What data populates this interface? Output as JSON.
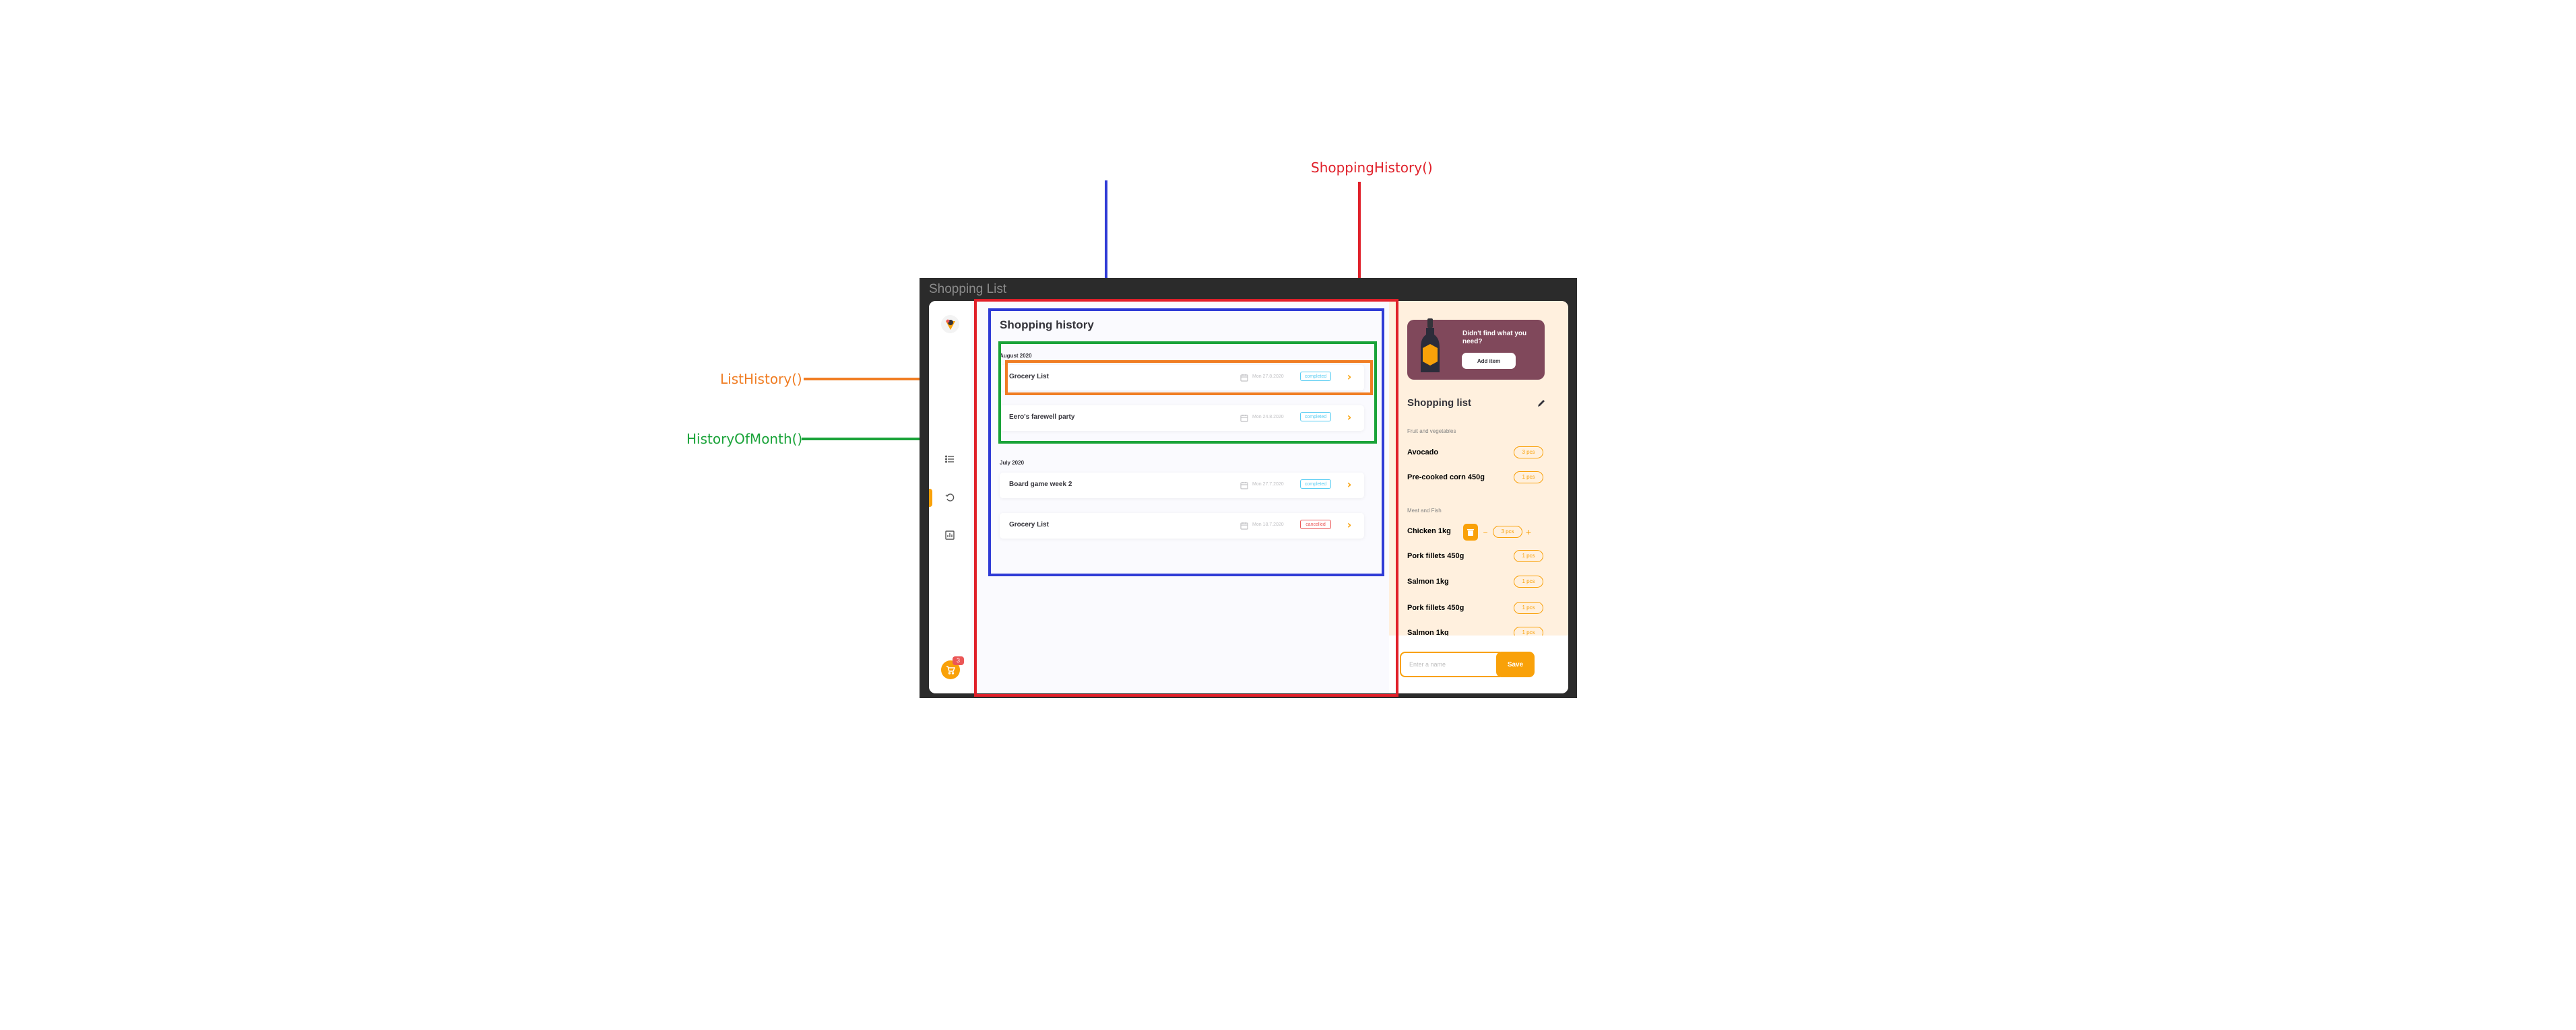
{
  "annotations": {
    "shopping_history": "ShoppingHistory()",
    "list_history": "ListHistory()",
    "history_of_month": "HistoryOfMonth()",
    "colors": {
      "red": "#e0202a",
      "blue": "#2f3bd6",
      "green": "#1aa339",
      "orange": "#f07d23"
    }
  },
  "window": {
    "title": "Shopping List"
  },
  "sidebar": {
    "icons": [
      "logo-icon",
      "list-icon",
      "history-icon",
      "statistics-icon"
    ],
    "cart_count": "3"
  },
  "main": {
    "title": "Shopping history",
    "months": [
      {
        "label": "August 2020",
        "lists": [
          {
            "name": "Grocery List",
            "date": "Mon 27.8.2020",
            "status": "completed"
          },
          {
            "name": "Eero's farewell party",
            "date": "Mon 24.8.2020",
            "status": "completed"
          }
        ]
      },
      {
        "label": "July 2020",
        "lists": [
          {
            "name": "Board game week 2",
            "date": "Mon 27.7.2020",
            "status": "completed"
          },
          {
            "name": "Grocery List",
            "date": "Mon 18.7.2020",
            "status": "cancelled"
          }
        ]
      }
    ]
  },
  "right_panel": {
    "promo_text": "Didn't find what you need?",
    "promo_button": "Add item",
    "list_title": "Shopping list",
    "categories": [
      {
        "name": "Fruit and vegetables",
        "items": [
          {
            "name": "Avocado",
            "qty": "3 pcs"
          },
          {
            "name": "Pre-cooked corn 450g",
            "qty": "1 pcs"
          }
        ]
      },
      {
        "name": "Meat and Fish",
        "items": [
          {
            "name": "Chicken 1kg",
            "qty": "3 pcs"
          },
          {
            "name": "Pork fillets 450g",
            "qty": "1 pcs"
          },
          {
            "name": "Salmon 1kg",
            "qty": "1 pcs"
          },
          {
            "name": "Pork fillets 450g",
            "qty": "1 pcs"
          },
          {
            "name": "Salmon 1kg",
            "qty": "1 pcs"
          }
        ]
      }
    ],
    "input_placeholder": "Enter a name",
    "save_label": "Save"
  },
  "accent": "#f9a109"
}
